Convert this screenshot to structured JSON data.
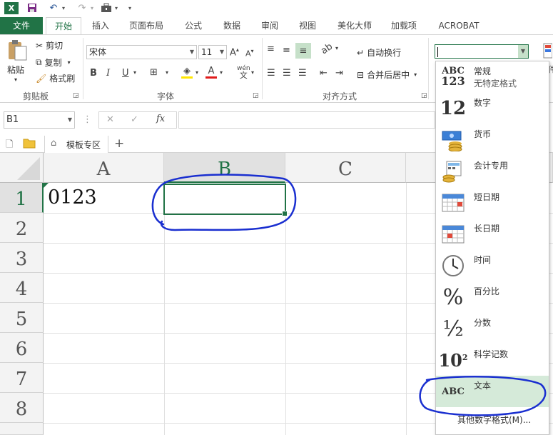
{
  "quick_access": {
    "app_icon": "excel-icon",
    "save_icon": "save-icon",
    "undo_icon": "undo-icon",
    "redo_icon": "redo-icon",
    "extra_icon": "toolbox-icon",
    "customize_icon": "customize-qat-icon"
  },
  "tabs": [
    "文件",
    "开始",
    "插入",
    "页面布局",
    "公式",
    "数据",
    "审阅",
    "视图",
    "美化大师",
    "加载项",
    "ACROBAT"
  ],
  "ribbon": {
    "clipboard": {
      "paste": "粘贴",
      "cut": "剪切",
      "copy": "复制",
      "format_painter": "格式刷",
      "label": "剪贴板"
    },
    "font": {
      "name": "宋体",
      "size": "11",
      "grow": "A",
      "shrink": "A",
      "bold": "B",
      "italic": "I",
      "underline": "U",
      "label": "字体",
      "wen": "wén",
      "wen2": "文"
    },
    "alignment": {
      "wrap": "自动换行",
      "merge": "合并后居中",
      "label": "对齐方式"
    },
    "number": {
      "format_value": ""
    }
  },
  "formula_bar": {
    "name_box": "B1",
    "cancel": "✕",
    "enter": "✓",
    "fx": "fx",
    "value": ""
  },
  "sheet_tabs": {
    "template": "模板专区",
    "add": "+"
  },
  "grid": {
    "columns": [
      "A",
      "B",
      "C"
    ],
    "rows": [
      "1",
      "2",
      "3",
      "4",
      "5",
      "6",
      "7",
      "8"
    ],
    "cell_a1": "0123",
    "selected": "B1"
  },
  "number_format_menu": {
    "items": [
      {
        "label": "常规",
        "sub": "无特定格式",
        "icon": "general-format-icon",
        "glyph": "ABC\n123"
      },
      {
        "label": "数字",
        "icon": "number-format-icon",
        "glyph": "12"
      },
      {
        "label": "货币",
        "icon": "currency-format-icon"
      },
      {
        "label": "会计专用",
        "icon": "accounting-format-icon"
      },
      {
        "label": "短日期",
        "icon": "short-date-format-icon"
      },
      {
        "label": "长日期",
        "icon": "long-date-format-icon"
      },
      {
        "label": "时间",
        "icon": "time-format-icon"
      },
      {
        "label": "百分比",
        "icon": "percentage-format-icon",
        "glyph": "%"
      },
      {
        "label": "分数",
        "icon": "fraction-format-icon",
        "glyph": "½"
      },
      {
        "label": "科学记数",
        "icon": "scientific-format-icon",
        "glyph": "10",
        "sup": "2"
      },
      {
        "label": "文本",
        "icon": "text-format-icon",
        "glyph": "ABC"
      }
    ],
    "more": "其他数字格式(M)..."
  },
  "colors": {
    "excel_green": "#217346",
    "annotation_blue": "#1a2fd0",
    "hover": "#d5ead9"
  }
}
